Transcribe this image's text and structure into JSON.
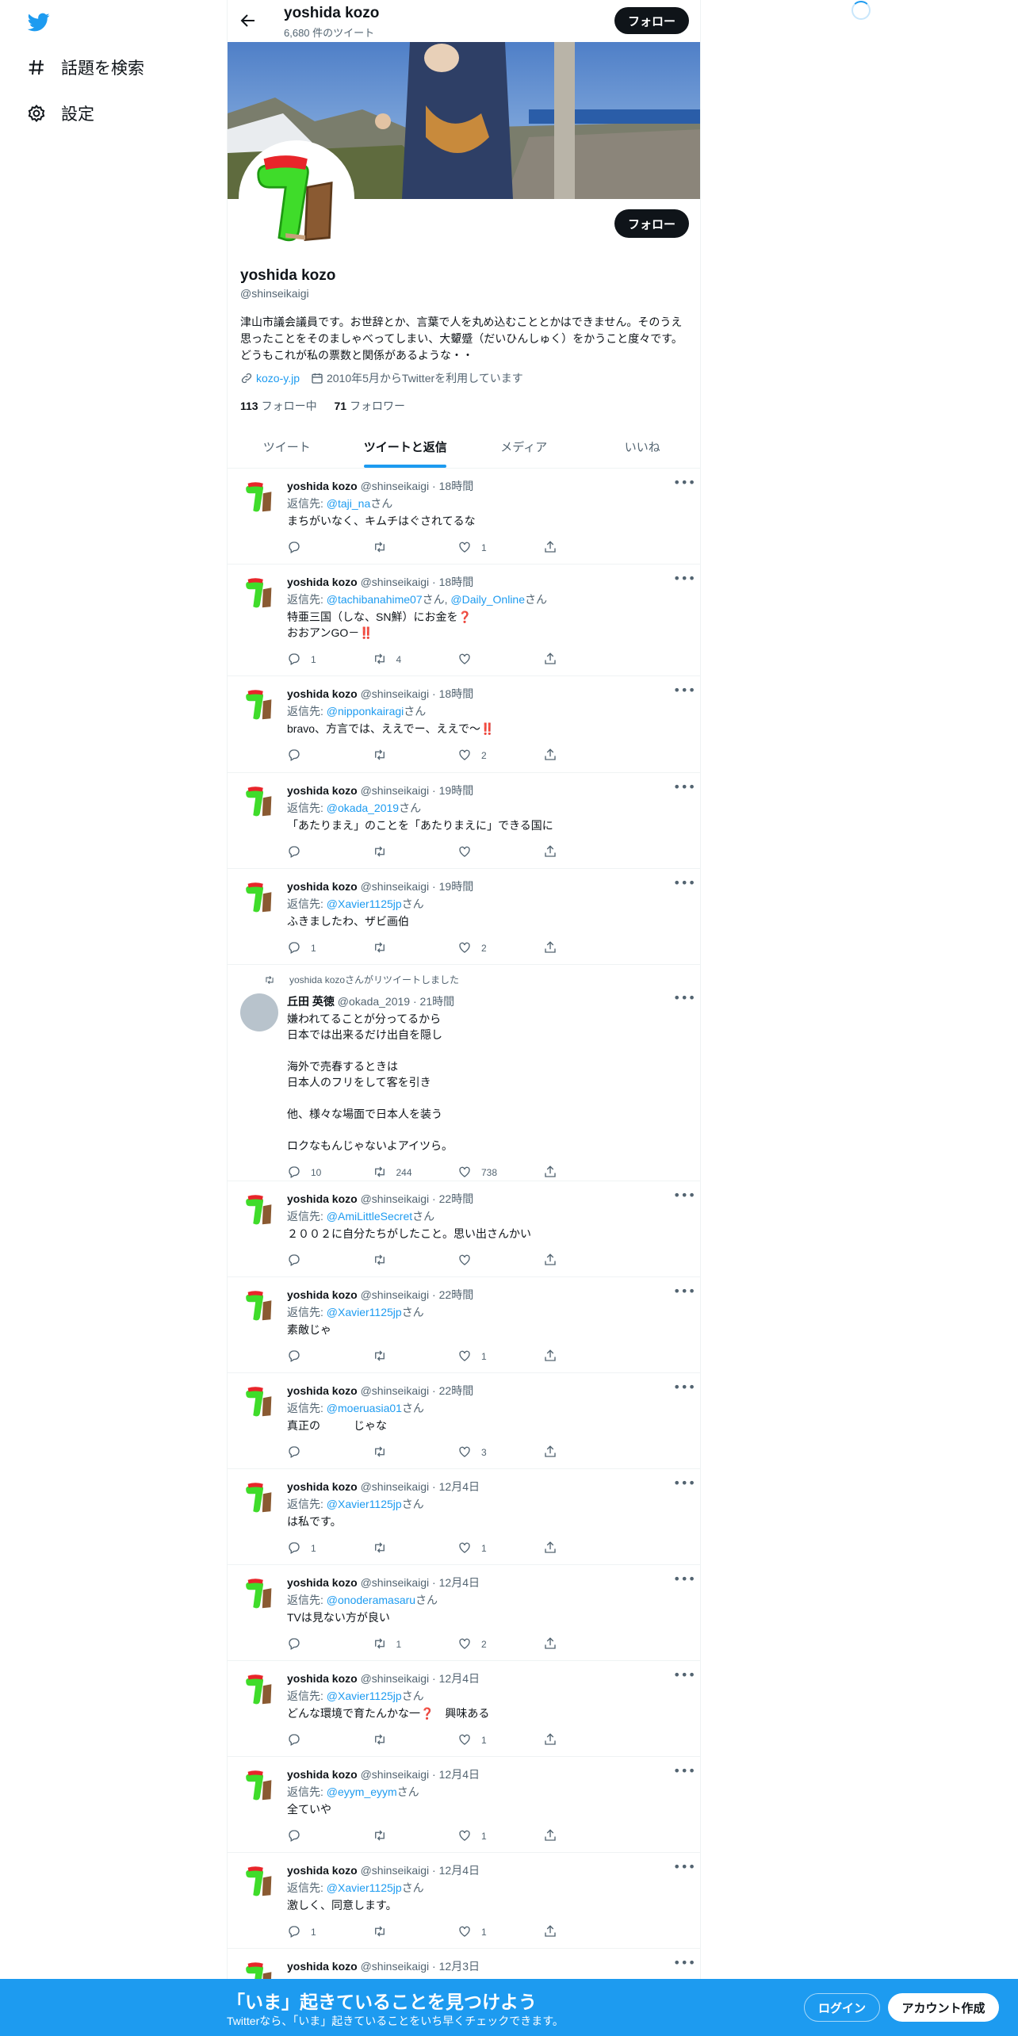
{
  "nav": {
    "explore_label": "話題を検索",
    "settings_label": "設定"
  },
  "header": {
    "name": "yoshida kozo",
    "tweet_count": "6,680 件のツイート",
    "follow_label": "フォロー"
  },
  "profile": {
    "name": "yoshida kozo",
    "handle": "@shinseikaigi",
    "bio": "津山市議会議員です。お世辞とか、言葉で人を丸め込むこととかはできません。そのうえ思ったことをそのましゃべってしまい、大顰蹙（だいひんしゅく）をかうこと度々です。どうもこれが私の票数と関係があるような・・",
    "website": "kozo-y.jp",
    "joined": "2010年5月からTwitterを利用しています",
    "following_count": "113",
    "following_label": "フォロー中",
    "followers_count": "71",
    "followers_label": "フォロワー",
    "follow_label": "フォロー"
  },
  "tabs": [
    "ツイート",
    "ツイートと返信",
    "メディア",
    "いいね"
  ],
  "reply_prefix": "返信先: ",
  "reply_suffix": "さん",
  "retweet_label": "yoshida kozoさんがリツイートしました",
  "tweets": [
    {
      "name": "yoshida kozo",
      "handle": "@shinseikaigi",
      "time": "18時間",
      "reply_to": [
        "@taji_na"
      ],
      "text": "まちがいなく、キムチはぐされてるな",
      "replies": "",
      "retweets": "",
      "likes": "1"
    },
    {
      "name": "yoshida kozo",
      "handle": "@shinseikaigi",
      "time": "18時間",
      "reply_to": [
        "@tachibanahime07",
        "@Daily_Online"
      ],
      "text": "特亜三国（しな、SN鮮）にお金を❓\nおおアンGO－‼️",
      "replies": "1",
      "retweets": "4",
      "likes": ""
    },
    {
      "name": "yoshida kozo",
      "handle": "@shinseikaigi",
      "time": "18時間",
      "reply_to": [
        "@nipponkairagi"
      ],
      "text": "bravo、方言では、ええでー、ええで～‼️",
      "replies": "",
      "retweets": "",
      "likes": "2"
    },
    {
      "name": "yoshida kozo",
      "handle": "@shinseikaigi",
      "time": "19時間",
      "reply_to": [
        "@okada_2019"
      ],
      "text": "「あたりまえ」のことを「あたりまえに」できる国に",
      "replies": "",
      "retweets": "",
      "likes": ""
    },
    {
      "name": "yoshida kozo",
      "handle": "@shinseikaigi",
      "time": "19時間",
      "reply_to": [
        "@Xavier1125jp"
      ],
      "text": "ふきましたわ、ザビ画伯",
      "replies": "1",
      "retweets": "",
      "likes": "2"
    },
    {
      "name": "丘田 英徳",
      "handle": "@okada_2019",
      "time": "21時間",
      "retweet": true,
      "text": "嫌われてることが分ってるから\n日本では出来るだけ出自を隠し\n\n海外で売春するときは\n日本人のフリをして客を引き\n\n他、様々な場面で日本人を装う\n\nロクなもんじゃないよアイツら。",
      "replies": "10",
      "retweets": "244",
      "likes": "738"
    },
    {
      "name": "yoshida kozo",
      "handle": "@shinseikaigi",
      "time": "22時間",
      "reply_to": [
        "@AmiLittleSecret"
      ],
      "text": "２００２に自分たちがしたこと。思い出さんかい",
      "replies": "",
      "retweets": "",
      "likes": ""
    },
    {
      "name": "yoshida kozo",
      "handle": "@shinseikaigi",
      "time": "22時間",
      "reply_to": [
        "@Xavier1125jp"
      ],
      "text": "素敵じゃ",
      "replies": "",
      "retweets": "",
      "likes": "1"
    },
    {
      "name": "yoshida kozo",
      "handle": "@shinseikaigi",
      "time": "22時間",
      "reply_to": [
        "@moeruasia01"
      ],
      "text": "真正の　　　じゃな",
      "replies": "",
      "retweets": "",
      "likes": "3"
    },
    {
      "name": "yoshida kozo",
      "handle": "@shinseikaigi",
      "time": "12月4日",
      "reply_to": [
        "@Xavier1125jp"
      ],
      "text": "は私です。",
      "replies": "1",
      "retweets": "",
      "likes": "1"
    },
    {
      "name": "yoshida kozo",
      "handle": "@shinseikaigi",
      "time": "12月4日",
      "reply_to": [
        "@onoderamasaru"
      ],
      "text": "TVは見ない方が良い",
      "replies": "",
      "retweets": "1",
      "likes": "2"
    },
    {
      "name": "yoshida kozo",
      "handle": "@shinseikaigi",
      "time": "12月4日",
      "reply_to": [
        "@Xavier1125jp"
      ],
      "text": "どんな環境で育たんかな一❓　興味ある",
      "replies": "",
      "retweets": "",
      "likes": "1"
    },
    {
      "name": "yoshida kozo",
      "handle": "@shinseikaigi",
      "time": "12月4日",
      "reply_to": [
        "@eyym_eyym"
      ],
      "text": "全ていや",
      "replies": "",
      "retweets": "",
      "likes": "1"
    },
    {
      "name": "yoshida kozo",
      "handle": "@shinseikaigi",
      "time": "12月4日",
      "reply_to": [
        "@Xavier1125jp"
      ],
      "text": "激しく、同意します。",
      "replies": "1",
      "retweets": "",
      "likes": "1"
    },
    {
      "name": "yoshida kozo",
      "handle": "@shinseikaigi",
      "time": "12月3日",
      "reply_to": [],
      "text": "",
      "replies": "",
      "retweets": "",
      "likes": ""
    }
  ],
  "bottom_bar": {
    "title": "「いま」起きていることを見つけよう",
    "subtitle": "Twitterなら、「いま」起きていることをいち早くチェックできます。",
    "login_label": "ログイン",
    "signup_label": "アカウント作成"
  },
  "colors": {
    "accent": "#1d9bf0",
    "dark": "#0f1419",
    "muted": "#536471"
  }
}
